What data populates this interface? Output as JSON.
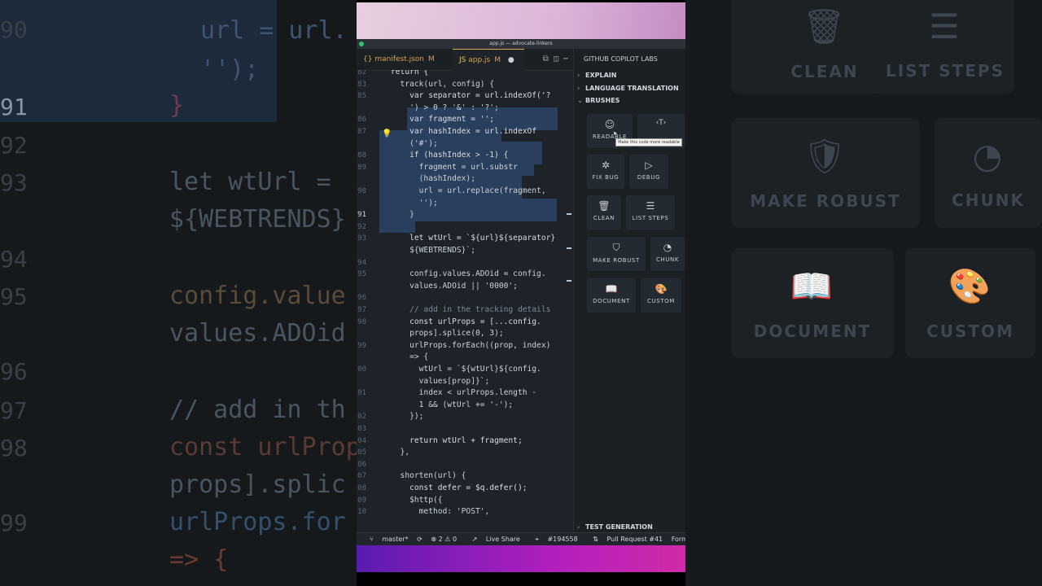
{
  "window_title": "app.js — advocate-linkers",
  "tabs": [
    {
      "label": "manifest.json",
      "badge": "M"
    },
    {
      "label": "app.js",
      "badge": "M"
    }
  ],
  "code": {
    "lines": [
      {
        "n": "82",
        "text": "return {"
      },
      {
        "n": "83",
        "text": "  track(url, config) {"
      },
      {
        "n": "85",
        "text": "    var separator = url.indexOf('?"
      },
      {
        "n": "",
        "text": "    ') > 0 ? '&' : '?';"
      },
      {
        "n": "86",
        "text": "    var fragment = '';"
      },
      {
        "n": "87",
        "text": "    var hashIndex = url.indexOf"
      },
      {
        "n": "",
        "text": "    ('#');"
      },
      {
        "n": "88",
        "text": "    if (hashIndex > -1) {"
      },
      {
        "n": "89",
        "text": "      fragment = url.substr"
      },
      {
        "n": "",
        "text": "      (hashIndex);"
      },
      {
        "n": "90",
        "text": "      url = url.replace(fragment,"
      },
      {
        "n": "",
        "text": "      '');"
      },
      {
        "n": "91",
        "text": "    }"
      },
      {
        "n": "92",
        "text": ""
      },
      {
        "n": "93",
        "text": "    let wtUrl = `${url}${separator}"
      },
      {
        "n": "",
        "text": "    ${WEBTRENDS}`;"
      },
      {
        "n": "94",
        "text": ""
      },
      {
        "n": "95",
        "text": "    config.values.ADOid = config."
      },
      {
        "n": "",
        "text": "    values.ADOid || '0000';"
      },
      {
        "n": "96",
        "text": ""
      },
      {
        "n": "97",
        "text": "    // add in the tracking details"
      },
      {
        "n": "98",
        "text": "    const urlProps = [...config."
      },
      {
        "n": "",
        "text": "    props].splice(0, 3);"
      },
      {
        "n": "99",
        "text": "    urlProps.forEach((prop, index)"
      },
      {
        "n": "",
        "text": "    => {"
      },
      {
        "n": "00",
        "text": "      wtUrl = `${wtUrl}${config."
      },
      {
        "n": "",
        "text": "      values[prop]}`;"
      },
      {
        "n": "01",
        "text": "      index < urlProps.length -"
      },
      {
        "n": "",
        "text": "      1 && (wtUrl += '-');"
      },
      {
        "n": "02",
        "text": "    });"
      },
      {
        "n": "03",
        "text": ""
      },
      {
        "n": "04",
        "text": "    return wtUrl + fragment;"
      },
      {
        "n": "05",
        "text": "  },"
      },
      {
        "n": "06",
        "text": ""
      },
      {
        "n": "07",
        "text": "  shorten(url) {"
      },
      {
        "n": "08",
        "text": "    const defer = $q.defer();"
      },
      {
        "n": "09",
        "text": "    $http({"
      },
      {
        "n": "10",
        "text": "      method: 'POST',"
      }
    ]
  },
  "panel": {
    "title": "GITHUB COPILOT LABS",
    "sections": {
      "explain": "EXPLAIN",
      "translation": "LANGUAGE TRANSLATION",
      "brushes": "BRUSHES",
      "test": "TEST GENERATION"
    },
    "brushes": [
      {
        "id": "readable",
        "label": "READABLE",
        "icon": "smiley-icon"
      },
      {
        "id": "types",
        "label": "",
        "icon": "type-brackets-icon"
      },
      {
        "id": "fix-bug",
        "label": "FIX BUG",
        "icon": "bug-icon"
      },
      {
        "id": "debug",
        "label": "DEBUG",
        "icon": "debug-play-icon"
      },
      {
        "id": "clean",
        "label": "CLEAN",
        "icon": "trash-icon"
      },
      {
        "id": "list-steps",
        "label": "LIST STEPS",
        "icon": "list-icon"
      },
      {
        "id": "make-robust",
        "label": "MAKE ROBUST",
        "icon": "shield-check-icon"
      },
      {
        "id": "chunk",
        "label": "CHUNK",
        "icon": "pie-icon"
      },
      {
        "id": "document",
        "label": "DOCUMENT",
        "icon": "book-icon"
      },
      {
        "id": "custom",
        "label": "CUSTOM",
        "icon": "palette-icon"
      }
    ],
    "tooltip": "Make this code more readable"
  },
  "statusbar": {
    "branch": "master*",
    "problems": "⊗ 2 ⚠ 0",
    "live_share": "Live Share",
    "issue": "#194558",
    "pr": "Pull Request #41",
    "formatting": "Formatting: ✓"
  },
  "background": {
    "left_numbers": [
      "90",
      "91",
      "92",
      "93",
      "94",
      "95",
      "96",
      "97",
      "98",
      "99"
    ],
    "left_code": [
      "url = url.",
      "'');",
      "}",
      "let wtUrl =",
      "${WEBTRENDS}",
      "config.value",
      "values.ADOid",
      "// add in th",
      "const urlProp",
      "props].splic",
      "urlProps.for",
      "=> {"
    ],
    "right_tiles": [
      "CLEAN",
      "LIST STEPS",
      "MAKE ROBUST",
      "CHUNK",
      "DOCUMENT",
      "CUSTOM"
    ]
  }
}
